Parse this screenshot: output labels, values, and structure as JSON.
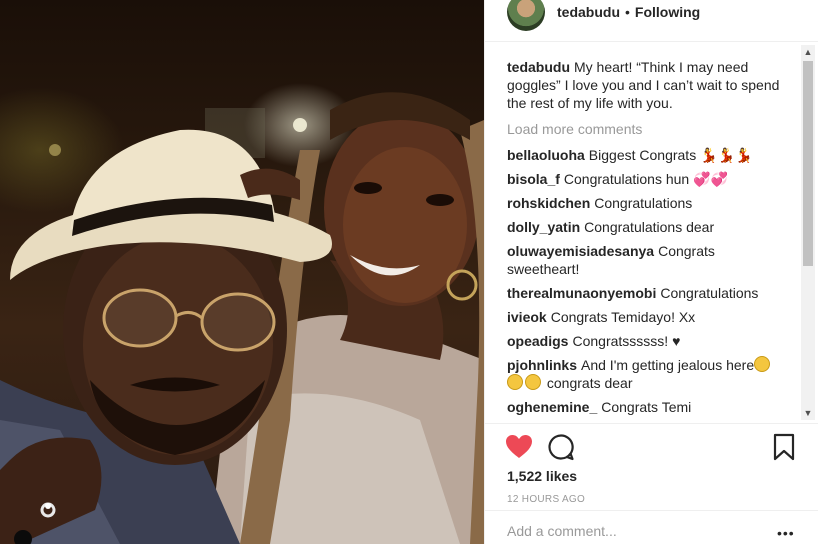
{
  "header": {
    "username": "tedabudu",
    "separator": "•",
    "follow_status": "Following"
  },
  "caption": {
    "username": "tedabudu",
    "text": "My heart! “Think I may need goggles” I love you and I can’t wait to spend the rest of my life with you."
  },
  "load_more": "Load more comments",
  "comments": [
    {
      "username": "bellaoluoha",
      "text": "Biggest Congrats",
      "emoji": "💃💃💃"
    },
    {
      "username": "bisola_f",
      "text": "Congratulations hun",
      "emoji": "💞💞"
    },
    {
      "username": "rohskidchen",
      "text": "Congratulations"
    },
    {
      "username": "dolly_yatin",
      "text": "Congratulations dear"
    },
    {
      "username": "oluwayemisiadesanya",
      "text": "Congrats sweetheart!"
    },
    {
      "username": "therealmunaonyemobi",
      "text": "Congratulations"
    },
    {
      "username": "ivieok",
      "text": "Congrats Temidayo! Xx"
    },
    {
      "username": "opeadigs",
      "text": "Congratssssss!",
      "emoji": "♥"
    },
    {
      "username": "pjohnlinks",
      "text": "And I'm getting jealous here",
      "text2": "congrats dear"
    },
    {
      "username": "oghenemine_",
      "text": "Congrats Temi"
    }
  ],
  "likes": "1,522 likes",
  "timestamp": "12 HOURS AGO",
  "add_comment_placeholder": "Add a comment...",
  "more_label": "•••",
  "colors": {
    "heart": "#ed4956",
    "accent": "#262626",
    "muted": "#999999"
  }
}
